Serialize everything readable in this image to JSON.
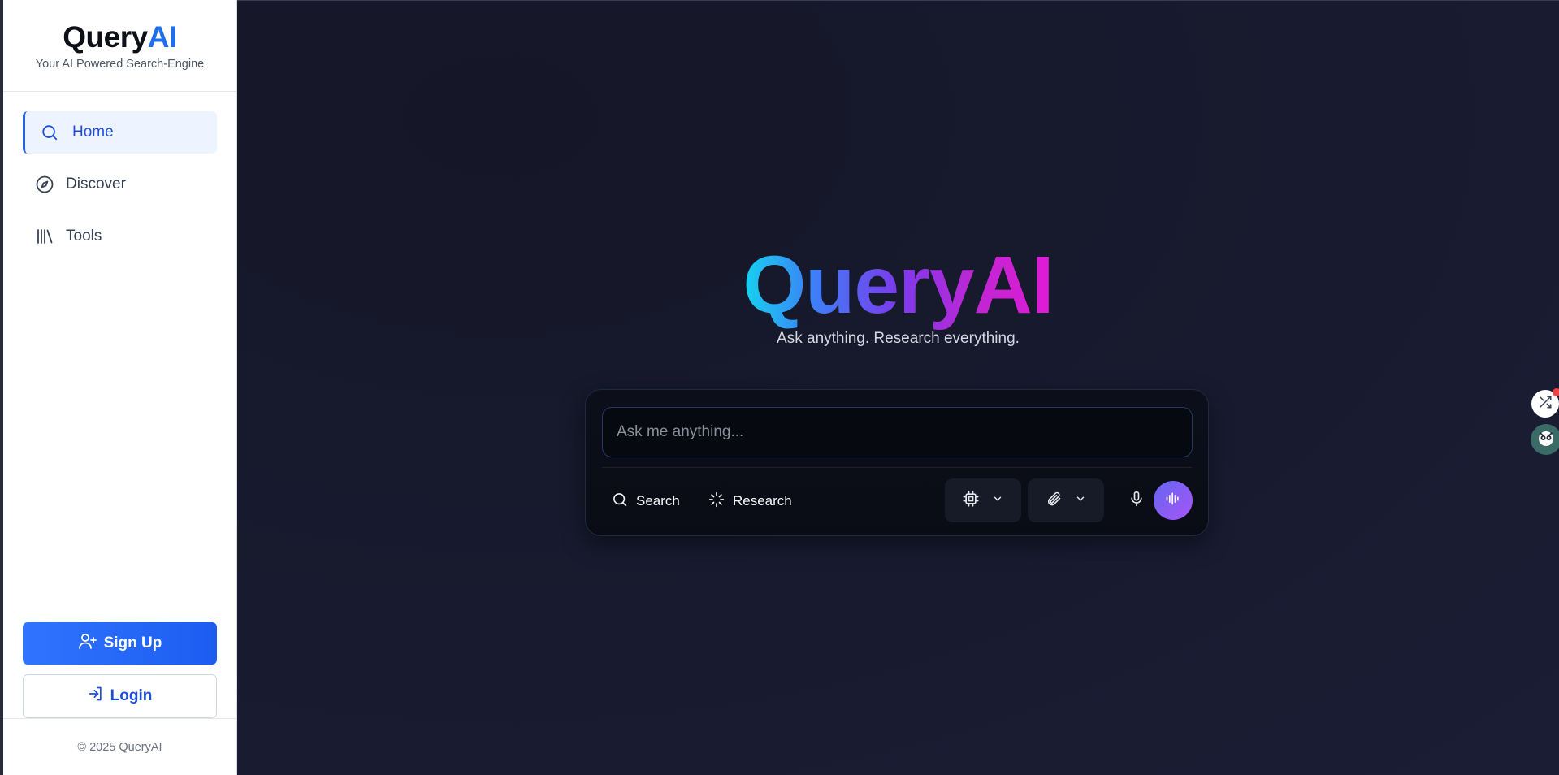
{
  "sidebar": {
    "brand_main": "Query",
    "brand_accent": "AI",
    "tagline": "Your AI Powered Search-Engine",
    "items": [
      {
        "label": "Home",
        "icon": "search-icon",
        "active": true
      },
      {
        "label": "Discover",
        "icon": "compass-icon",
        "active": false
      },
      {
        "label": "Tools",
        "icon": "library-icon",
        "active": false
      }
    ],
    "signup_label": "Sign Up",
    "login_label": "Login",
    "footer": "© 2025 QueryAI"
  },
  "hero": {
    "title": "QueryAI",
    "subtitle": "Ask anything. Research everything."
  },
  "query": {
    "placeholder": "Ask me anything...",
    "value": "",
    "modes": [
      {
        "label": "Search",
        "icon": "search-icon"
      },
      {
        "label": "Research",
        "icon": "loader-icon"
      }
    ],
    "model_icon": "cpu-icon",
    "attach_icon": "paperclip-icon",
    "mic_icon": "microphone-icon",
    "voice_icon": "audio-wave-icon"
  },
  "colors": {
    "accent": "#1f6feb",
    "signup_bg": "#2563eb",
    "title_gradient": [
      "#16d3f0",
      "#3b82f6",
      "#7c3aed",
      "#c026d3",
      "#e11ad6"
    ],
    "main_bg": "#171a2d",
    "voice_gradient": [
      "#6366f1",
      "#a855f7"
    ]
  }
}
